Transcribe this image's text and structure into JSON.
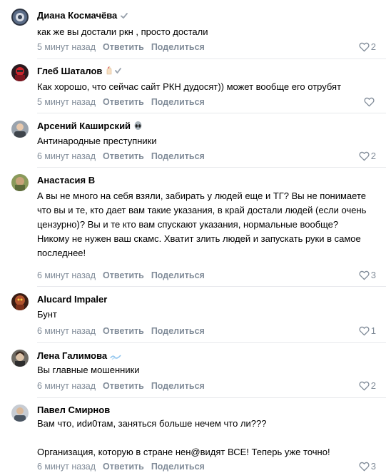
{
  "labels": {
    "reply": "Ответить",
    "share": "Поделиться"
  },
  "colors": {
    "meta": "#818c99",
    "divider": "#e7e8ec"
  },
  "comments": [
    {
      "author": "Диана Космачёва",
      "badge": "verified-check-icon",
      "text": "как же вы достали ркн , просто достали",
      "time": "5 минут назад",
      "likes": "2"
    },
    {
      "author": "Глеб Шаталов",
      "badge": "hand-emoji-icon",
      "text": "Как хорошо, что сейчас сайт РКН дудосят)) может вообще его отрубят",
      "time": "5 минут назад",
      "likes": ""
    },
    {
      "author": "Арсений Каширский",
      "badge": "alien-emoji-icon",
      "text": "Антинародные преступники",
      "time": "6 минут назад",
      "likes": "2"
    },
    {
      "author": "Анастасия В",
      "badge": "",
      "text": "А вы не много на себя взяли, забирать у людей еще и ТГ? Вы не понимаете что вы и те, кто дает вам такие указания, в край достали людей (если очень цензурно)? Вы и те кто вам спускают указания, нормальные вообще?\nНикому не нужен ваш скамс. Хватит злить людей и запускать руки в самое последнее!",
      "time": "6 минут назад",
      "likes": "3"
    },
    {
      "author": "Alucard Impaler",
      "badge": "",
      "text": "Бунт",
      "time": "6 минут назад",
      "likes": "1"
    },
    {
      "author": "Лена Галимова",
      "badge": "wave-emoji-icon",
      "text": "Вы главные мошенники",
      "time": "6 минут назад",
      "likes": "2"
    },
    {
      "author": "Павел Смирнов",
      "badge": "",
      "text": "Вам что, иdи0там, заняться больше нечем что ли???\n\nОрганизация, которую в стране нен@видят ВСЕ! Теперь уже точно!",
      "time": "6 минут назад",
      "likes": "3"
    }
  ]
}
